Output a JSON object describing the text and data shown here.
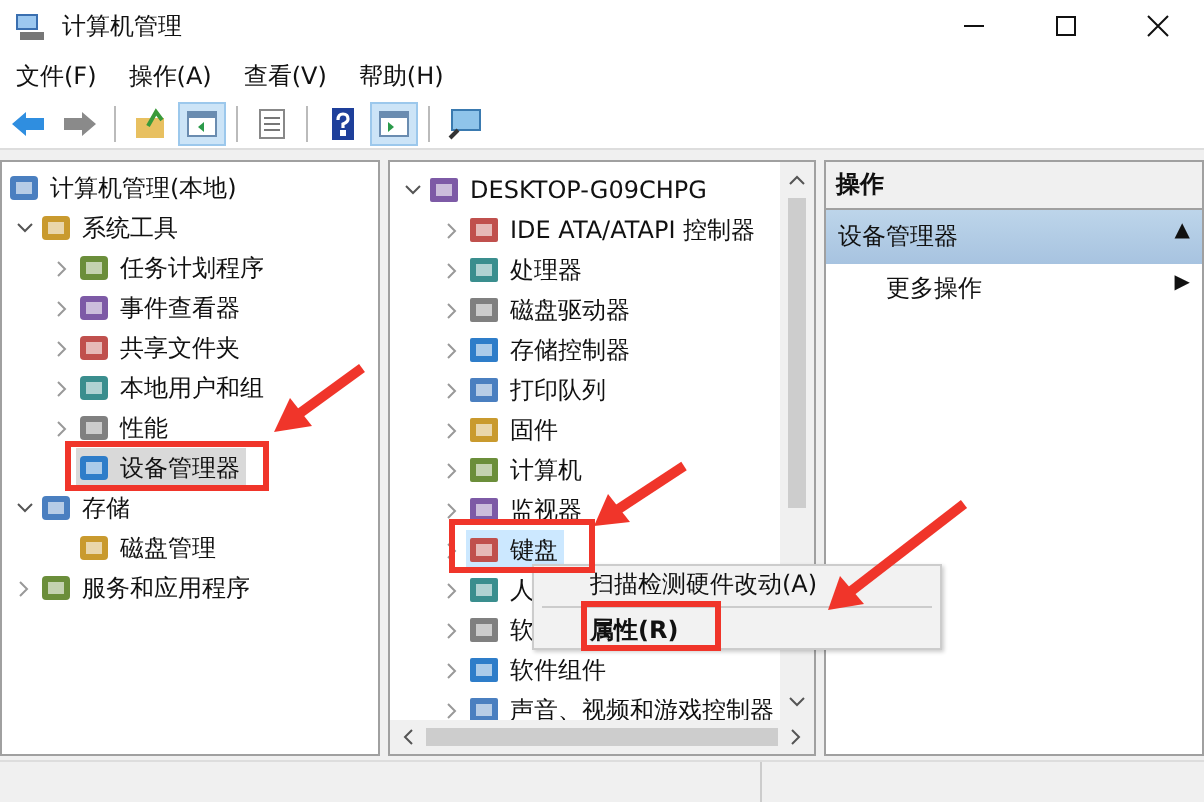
{
  "window": {
    "title": "计算机管理"
  },
  "menu": [
    "文件(F)",
    "操作(A)",
    "查看(V)",
    "帮助(H)"
  ],
  "toolbar": [
    {
      "pressed": false
    },
    {
      "pressed": false
    },
    {
      "pressed": false
    },
    {
      "pressed": true
    },
    {
      "pressed": false
    },
    {
      "pressed": false
    },
    {
      "pressed": true
    },
    {
      "pressed": false
    }
  ],
  "left_tree": [
    {
      "label": "计算机管理(本地)",
      "selected": false,
      "children": [
        {
          "label": "系统工具",
          "expanded": true,
          "selected": false,
          "children": [
            {
              "label": "任务计划程序",
              "expanded": false,
              "selected": false
            },
            {
              "label": "事件查看器",
              "expanded": false,
              "selected": false
            },
            {
              "label": "共享文件夹",
              "expanded": false,
              "selected": false
            },
            {
              "label": "本地用户和组",
              "expanded": false,
              "selected": false
            },
            {
              "label": "性能",
              "expanded": false,
              "selected": false
            },
            {
              "label": "设备管理器",
              "selected": true
            }
          ]
        },
        {
          "label": "存储",
          "expanded": true,
          "selected": false,
          "children": [
            {
              "label": "磁盘管理",
              "selected": false
            }
          ]
        },
        {
          "label": "服务和应用程序",
          "expanded": false,
          "selected": false
        }
      ]
    }
  ],
  "device_tree": [
    {
      "label": "DESKTOP-G09CHPG",
      "expanded": true,
      "selected": false,
      "children": [
        {
          "label": "IDE ATA/ATAPI 控制器",
          "expanded": false,
          "selected": false
        },
        {
          "label": "处理器",
          "expanded": false,
          "selected": false
        },
        {
          "label": "磁盘驱动器",
          "expanded": false,
          "selected": false
        },
        {
          "label": "存储控制器",
          "expanded": false,
          "selected": false
        },
        {
          "label": "打印队列",
          "expanded": false,
          "selected": false
        },
        {
          "label": "固件",
          "expanded": false,
          "selected": false
        },
        {
          "label": "计算机",
          "expanded": false,
          "selected": false
        },
        {
          "label": "监视器",
          "expanded": false,
          "selected": false
        },
        {
          "label": "键盘",
          "expanded": false,
          "selected": true
        },
        {
          "label": "人",
          "expanded": false,
          "selected": false
        },
        {
          "label": "软",
          "expanded": false,
          "selected": false
        },
        {
          "label": "软件组件",
          "expanded": false,
          "selected": false
        },
        {
          "label": "声音、视频和游戏控制器",
          "expanded": false,
          "selected": false
        }
      ]
    }
  ],
  "context_menu": [
    {
      "kind": "item",
      "label": "扫描检测硬件改动(A)",
      "default": false
    },
    {
      "kind": "separator"
    },
    {
      "kind": "item",
      "label": "属性(R)",
      "default": true
    }
  ],
  "actions": {
    "title": "操作",
    "section": {
      "label": "设备管理器",
      "arrow": "▲"
    },
    "items": [
      {
        "label": "更多操作",
        "arrow": "▶"
      }
    ]
  }
}
